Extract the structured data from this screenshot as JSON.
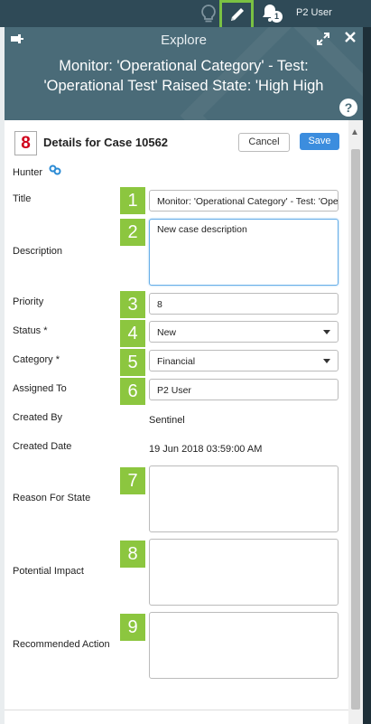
{
  "topbar": {
    "bulb_icon": "lightbulb-icon",
    "edit_icon": "pencil-icon",
    "bell_icon": "bell-icon",
    "notification_count": "1",
    "user_name": "P2 User"
  },
  "panel": {
    "header_title": "Explore",
    "case_title_line1": "Monitor: 'Operational Category' - Test:",
    "case_title_line2": "'Operational Test' Raised State: 'High High"
  },
  "form": {
    "step_number": "8",
    "details_title": "Details for Case 10562",
    "cancel_label": "Cancel",
    "save_label": "Save",
    "hunter_label": "Hunter",
    "fields": {
      "title_label": "Title",
      "title_value": "Monitor: 'Operational Category' - Test: 'Operational Test' Raised State",
      "description_label": "Description",
      "description_value": "New case description",
      "priority_label": "Priority",
      "priority_value": "8",
      "status_label": "Status *",
      "status_value": "New",
      "category_label": "Category *",
      "category_value": "Financial",
      "assigned_label": "Assigned To",
      "assigned_value": "P2 User",
      "created_by_label": "Created By",
      "created_by_value": "Sentinel",
      "created_date_label": "Created Date",
      "created_date_value": "19 Jun 2018 03:59:00 AM",
      "reason_label": "Reason For State",
      "impact_label": "Potential Impact",
      "recommended_label": "Recommended Action"
    },
    "callouts": [
      "1",
      "2",
      "3",
      "4",
      "5",
      "6",
      "7",
      "8",
      "9"
    ]
  },
  "colors": {
    "topbar_bg": "#2f4a57",
    "header_bg": "#4a6b78",
    "callout_green": "#8cc63f",
    "save_blue": "#3c8dde",
    "step_red": "#d0021b"
  }
}
